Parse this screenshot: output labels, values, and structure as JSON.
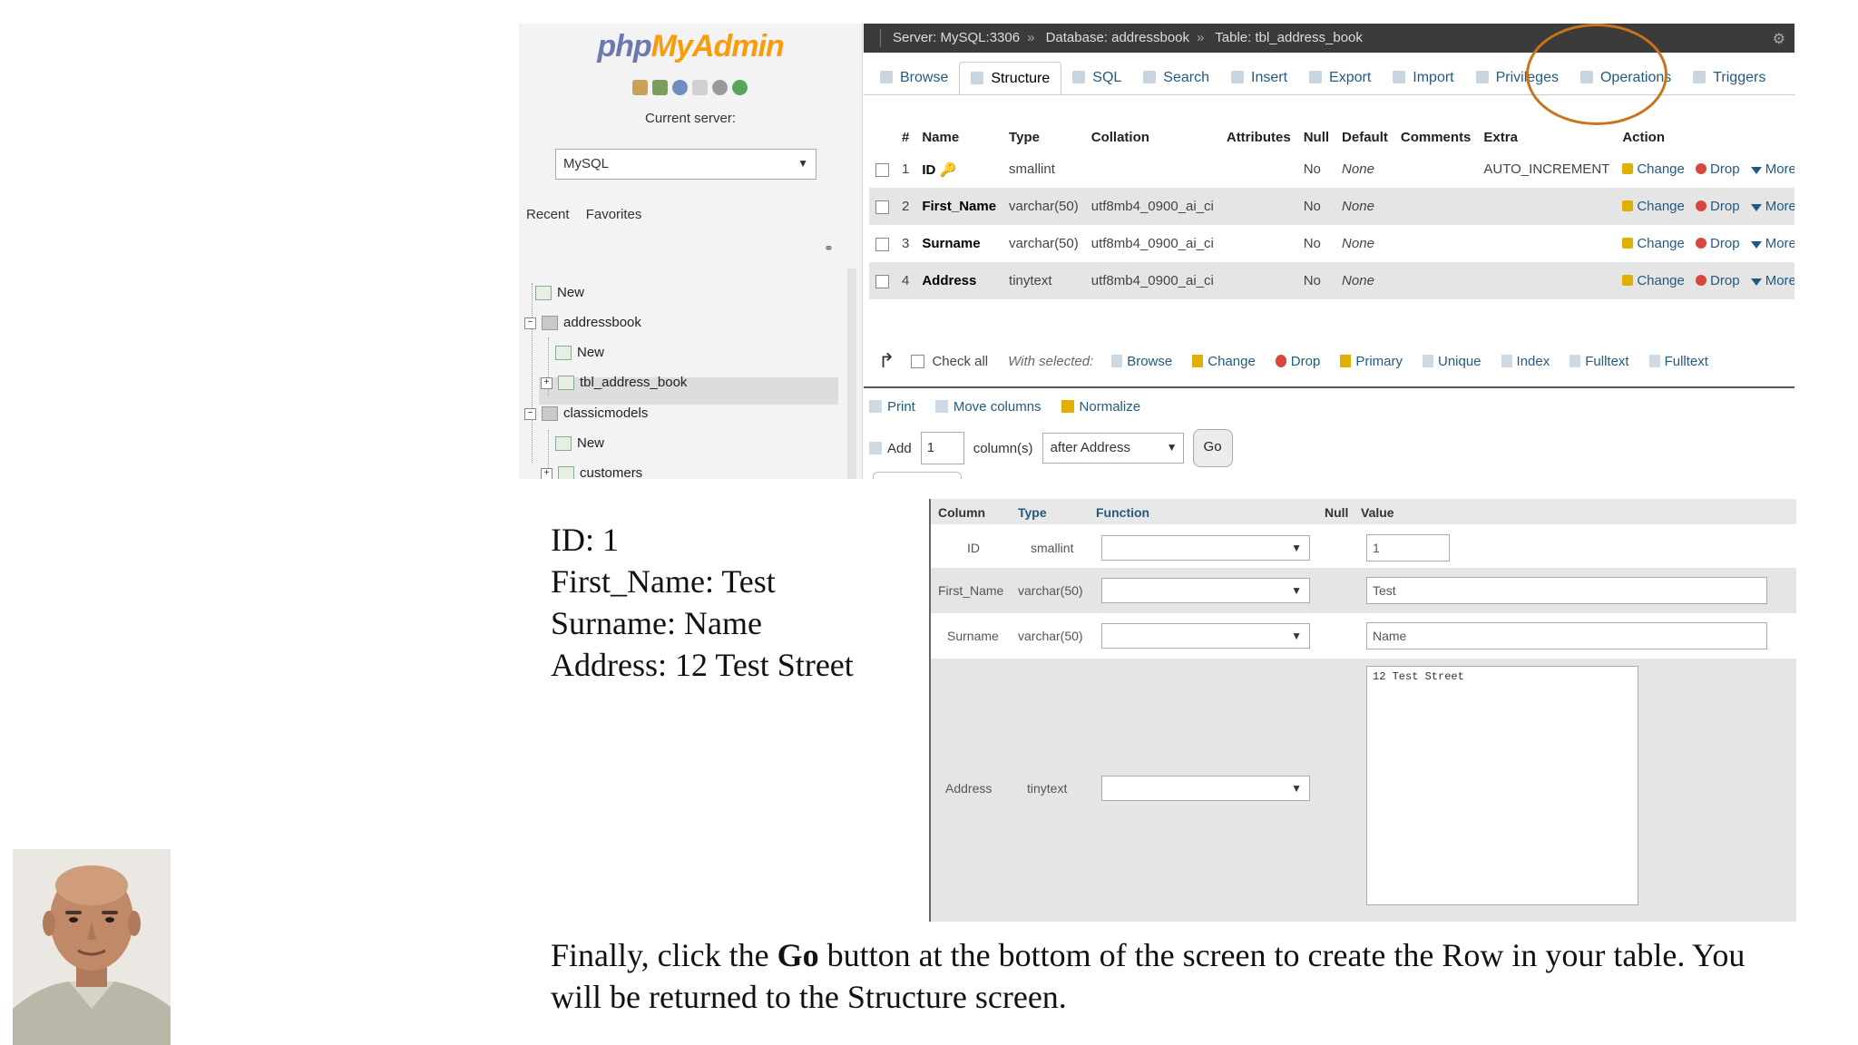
{
  "nav": {
    "logo_php": "php",
    "logo_my": "MyAdmin",
    "current_server_label": "Current server:",
    "server_select": "MySQL",
    "recent_tab": "Recent",
    "favorites_tab": "Favorites",
    "tree": [
      {
        "label": "New"
      },
      {
        "label": "addressbook"
      },
      {
        "label": "New"
      },
      {
        "label": "tbl_address_book"
      },
      {
        "label": "classicmodels"
      },
      {
        "label": "New"
      },
      {
        "label": "customers"
      }
    ]
  },
  "breadcrumb": {
    "server": "Server: MySQL:3306",
    "database": "Database: addressbook",
    "table": "Table: tbl_address_book"
  },
  "tabs": [
    "Browse",
    "Structure",
    "SQL",
    "Search",
    "Insert",
    "Export",
    "Import",
    "Privileges",
    "Operations",
    "Triggers"
  ],
  "structure": {
    "headers": [
      "#",
      "Name",
      "Type",
      "Collation",
      "Attributes",
      "Null",
      "Default",
      "Comments",
      "Extra",
      "Action"
    ],
    "rows": [
      {
        "num": "1",
        "name": "ID",
        "type": "smallint",
        "collation": "",
        "attributes": "",
        "null": "No",
        "default": "None",
        "comments": "",
        "extra": "AUTO_INCREMENT"
      },
      {
        "num": "2",
        "name": "First_Name",
        "type": "varchar(50)",
        "collation": "utf8mb4_0900_ai_ci",
        "attributes": "",
        "null": "No",
        "default": "None",
        "comments": "",
        "extra": ""
      },
      {
        "num": "3",
        "name": "Surname",
        "type": "varchar(50)",
        "collation": "utf8mb4_0900_ai_ci",
        "attributes": "",
        "null": "No",
        "default": "None",
        "comments": "",
        "extra": ""
      },
      {
        "num": "4",
        "name": "Address",
        "type": "tinytext",
        "collation": "utf8mb4_0900_ai_ci",
        "attributes": "",
        "null": "No",
        "default": "None",
        "comments": "",
        "extra": ""
      }
    ],
    "actions": {
      "change": "Change",
      "drop": "Drop",
      "more": "More"
    },
    "with_selected": {
      "check_all": "Check all",
      "label": "With selected:",
      "items": [
        "Browse",
        "Change",
        "Drop",
        "Primary",
        "Unique",
        "Index",
        "Fulltext",
        "Fulltext"
      ]
    },
    "tools": [
      "Print",
      "Move columns",
      "Normalize"
    ],
    "add": {
      "label": "Add",
      "count": "1",
      "columns_label": "column(s)",
      "position": "after Address",
      "go": "Go"
    }
  },
  "slide": {
    "fields": [
      "ID: 1",
      "First_Name: Test",
      "Surname: Name",
      "Address: 12 Test Street"
    ],
    "instruction_before": "Finally, click the ",
    "instruction_bold": "Go",
    "instruction_after": " button at the bottom of the screen to create the Row in your table. You will be returned to the Structure screen."
  },
  "insert_form": {
    "headers": {
      "column": "Column",
      "type": "Type",
      "function": "Function",
      "null": "Null",
      "value": "Value"
    },
    "rows": [
      {
        "column": "ID",
        "type": "smallint",
        "value": "1"
      },
      {
        "column": "First_Name",
        "type": "varchar(50)",
        "value": "Test"
      },
      {
        "column": "Surname",
        "type": "varchar(50)",
        "value": "Name"
      },
      {
        "column": "Address",
        "type": "tinytext",
        "value": "12 Test Street"
      }
    ]
  },
  "colors": {
    "link": "#235a81",
    "logo_php": "#6c78af",
    "logo_myadmin": "#f89c0e",
    "highlight_circle": "#c9741a"
  }
}
